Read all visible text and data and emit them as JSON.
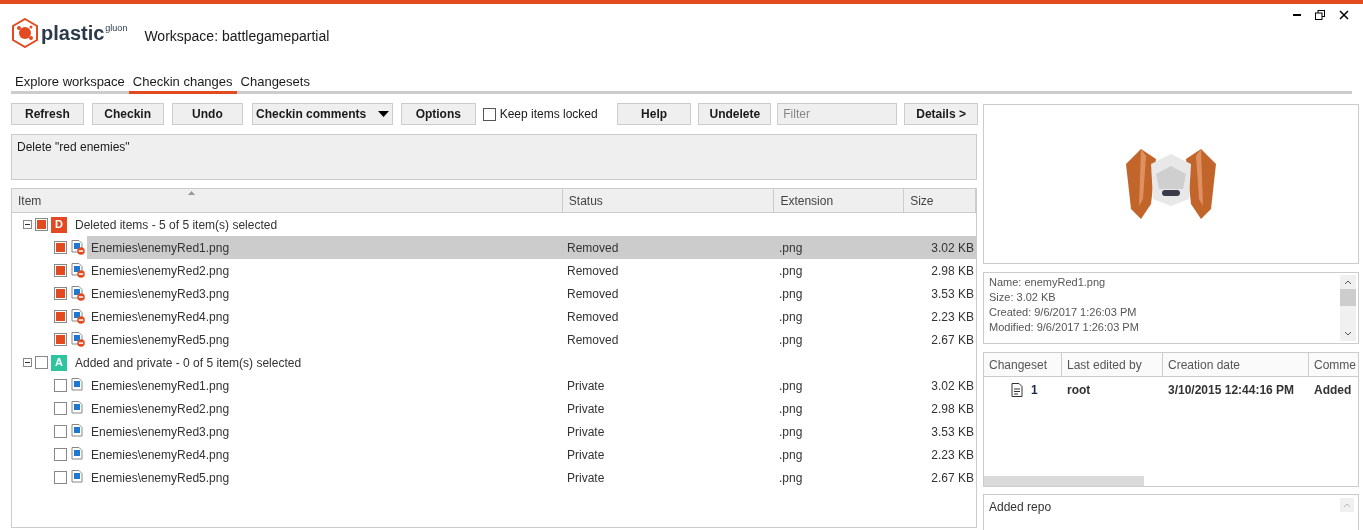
{
  "window": {
    "logo_text": "plastic",
    "logo_suffix": "gluon",
    "title": "Workspace: battlegamepartial"
  },
  "tabs": [
    {
      "label": "Explore workspace",
      "selected": false
    },
    {
      "label": "Checkin changes",
      "selected": true
    },
    {
      "label": "Changesets",
      "selected": false
    }
  ],
  "toolbar": [
    {
      "kind": "button",
      "label": "Refresh"
    },
    {
      "kind": "button",
      "label": "Checkin"
    },
    {
      "kind": "button",
      "label": "Undo"
    },
    {
      "kind": "dropdown",
      "label": "Checkin comments"
    },
    {
      "kind": "button",
      "label": "Options"
    },
    {
      "kind": "checkbox",
      "label": "Keep items locked",
      "checked": false
    },
    {
      "kind": "button",
      "label": "Help"
    },
    {
      "kind": "button",
      "label": "Undelete"
    },
    {
      "kind": "filter",
      "placeholder": "Filter"
    },
    {
      "kind": "button",
      "label": "Details >"
    }
  ],
  "comment": {
    "value": "Delete \"red enemies\""
  },
  "table": {
    "columns": [
      "Item",
      "Status",
      "Extension",
      "Size"
    ],
    "groups": [
      {
        "badge": "D",
        "color": "#e34a23",
        "label": "Deleted items - 5 of 5 item(s) selected",
        "checked": true,
        "expanded": true,
        "children": [
          {
            "item": "Enemies\\enemyRed1.png",
            "status": "Removed",
            "extension": ".png",
            "size": "3.02 KB",
            "checked": true,
            "selected": true,
            "kind": "removed"
          },
          {
            "item": "Enemies\\enemyRed2.png",
            "status": "Removed",
            "extension": ".png",
            "size": "2.98 KB",
            "checked": true,
            "selected": false,
            "kind": "removed"
          },
          {
            "item": "Enemies\\enemyRed3.png",
            "status": "Removed",
            "extension": ".png",
            "size": "3.53 KB",
            "checked": true,
            "selected": false,
            "kind": "removed"
          },
          {
            "item": "Enemies\\enemyRed4.png",
            "status": "Removed",
            "extension": ".png",
            "size": "2.23 KB",
            "checked": true,
            "selected": false,
            "kind": "removed"
          },
          {
            "item": "Enemies\\enemyRed5.png",
            "status": "Removed",
            "extension": ".png",
            "size": "2.67 KB",
            "checked": true,
            "selected": false,
            "kind": "removed"
          }
        ]
      },
      {
        "badge": "A",
        "color": "#2ec4a0",
        "label": "Added and private - 0 of 5 item(s) selected",
        "checked": false,
        "expanded": true,
        "children": [
          {
            "item": "Enemies\\enemyRed1.png",
            "status": "Private",
            "extension": ".png",
            "size": "3.02 KB",
            "checked": false,
            "selected": false,
            "kind": "private"
          },
          {
            "item": "Enemies\\enemyRed2.png",
            "status": "Private",
            "extension": ".png",
            "size": "2.98 KB",
            "checked": false,
            "selected": false,
            "kind": "private"
          },
          {
            "item": "Enemies\\enemyRed3.png",
            "status": "Private",
            "extension": ".png",
            "size": "3.53 KB",
            "checked": false,
            "selected": false,
            "kind": "private"
          },
          {
            "item": "Enemies\\enemyRed4.png",
            "status": "Private",
            "extension": ".png",
            "size": "2.23 KB",
            "checked": false,
            "selected": false,
            "kind": "private"
          },
          {
            "item": "Enemies\\enemyRed5.png",
            "status": "Private",
            "extension": ".png",
            "size": "2.67 KB",
            "checked": false,
            "selected": false,
            "kind": "private"
          }
        ]
      }
    ]
  },
  "details": {
    "preview": {
      "kind": "picture"
    },
    "info": [
      "Name: enemyRed1.png",
      "Size: 3.02 KB",
      "Created: 9/6/2017 1:26:03 PM",
      "Modified: 9/6/2017 1:26:03 PM"
    ],
    "history": {
      "columns": [
        "Changeset",
        "Last edited by",
        "Creation date",
        "Comme"
      ],
      "rows": [
        {
          "changeset": "1",
          "author": "root",
          "date": "3/10/2015 12:44:16 PM",
          "comment": "Added"
        }
      ]
    },
    "comment": "Added repo"
  }
}
